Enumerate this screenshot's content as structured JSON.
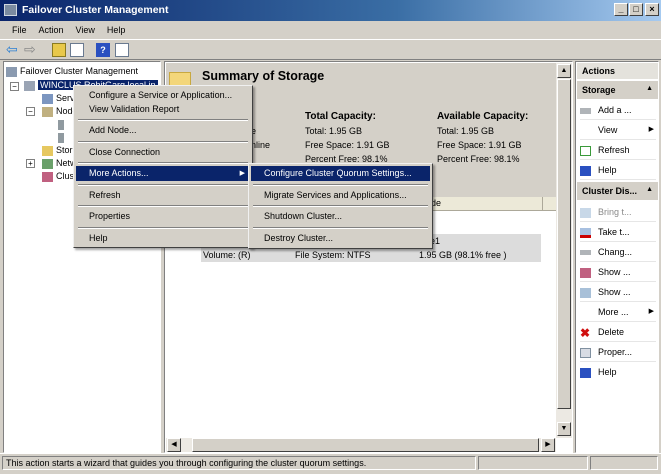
{
  "window": {
    "title": "Failover Cluster Management",
    "min": "_",
    "max": "□",
    "close": "×"
  },
  "menubar": [
    "File",
    "Action",
    "View",
    "Help"
  ],
  "tree": {
    "root": "Failover Cluster Management",
    "cluster": "WINCLUS.RohitGarg.local.in",
    "services": "Serv",
    "nodes": "Node",
    "storage": "Stor",
    "networks": "Netw",
    "events": "Clus"
  },
  "summary": {
    "title": "Summary of Storage",
    "col1": [
      "ne",
      "online"
    ],
    "total_capacity": {
      "header": "Total Capacity:",
      "total": "Total: 1.95 GB",
      "free": "Free Space: 1.91 GB",
      "percent": "Percent Free: 98.1%"
    },
    "available_capacity": {
      "header": "Available Capacity:",
      "total": "Total: 1.95 GB",
      "free": "Free Space: 1.91 GB",
      "percent": "Percent Free: 98.1%"
    }
  },
  "list": {
    "header_partial": "ode",
    "row1_partial": "de1",
    "volume": {
      "name": "Volume: (R)",
      "fs": "File System: NTFS",
      "size": "1.95 GB (98.1% free )"
    }
  },
  "context_menu": [
    "Configure a Service or Application...",
    "View Validation Report",
    "Add Node...",
    "Close Connection",
    "More Actions...",
    "Refresh",
    "Properties",
    "Help"
  ],
  "submenu": [
    "Configure Cluster Quorum Settings...",
    "Migrate Services and Applications...",
    "Shutdown Cluster...",
    "Destroy Cluster..."
  ],
  "actions": {
    "title": "Actions",
    "storage_header": "Storage",
    "storage": [
      "Add a ...",
      "View",
      "Refresh",
      "Help"
    ],
    "disk_header": "Cluster Dis...",
    "disk": [
      "Bring t...",
      "Take t...",
      "Chang...",
      "Show ...",
      "Show ...",
      "More ...",
      "Delete",
      "Proper...",
      "Help"
    ]
  },
  "status": "This action starts a wizard that guides you through configuring the cluster quorum settings.",
  "colors": {
    "selection": "#0a246a",
    "chrome": "#d4d0c8"
  }
}
